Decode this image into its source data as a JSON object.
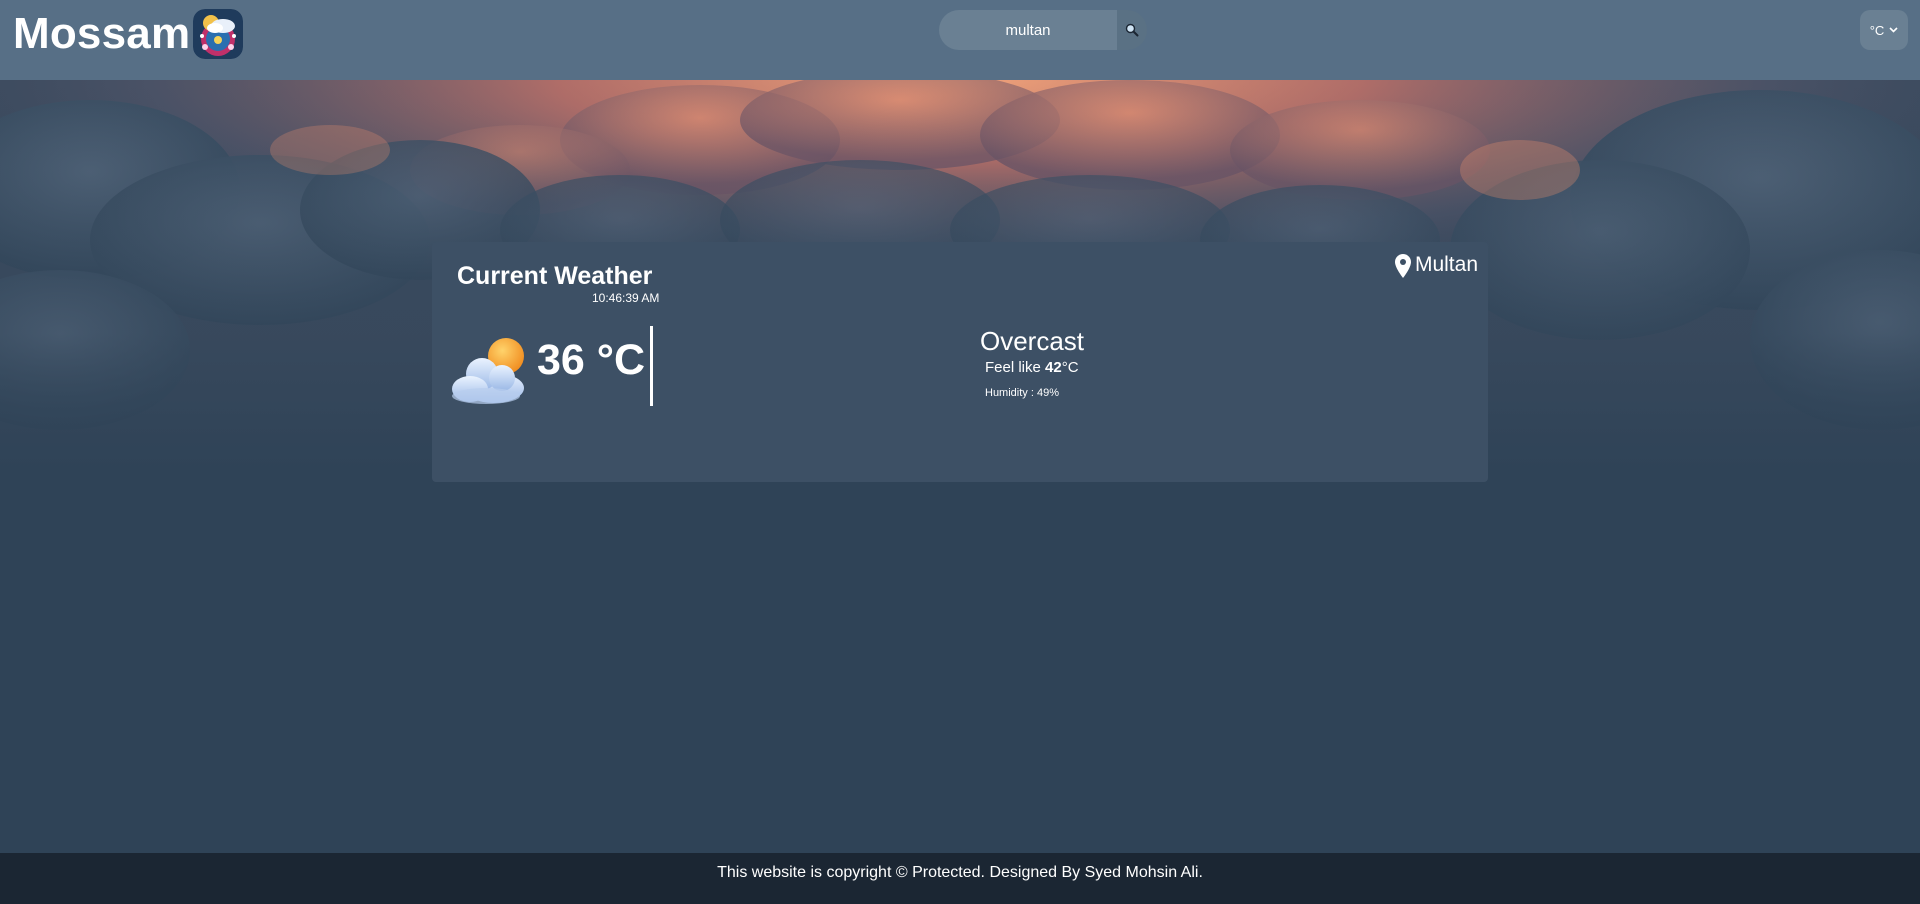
{
  "header": {
    "brand": "Mossam",
    "search": {
      "value": "multan",
      "placeholder": ""
    },
    "unit_selector": {
      "selected": "°C"
    }
  },
  "weather": {
    "title": "Current Weather",
    "time": "10:46:39 AM",
    "location": "Multan",
    "temperature": "36 °C",
    "condition": "Overcast",
    "feels_like_prefix": "Feel like ",
    "feels_like_value": "42",
    "feels_like_unit": "°C",
    "humidity": "Humidity : 49%",
    "icon": "partly-cloudy-icon"
  },
  "footer": {
    "text": "This website is copyright © Protected. Designed By Syed Mohsin Ali."
  },
  "colors": {
    "header_bg": "#576f86",
    "page_bg": "#2f4357",
    "card_bg": "#3d5065",
    "footer_bg": "#1b2633",
    "sky_glow": "#e8906e"
  },
  "icons": [
    "search-icon",
    "location-pin-icon",
    "chevron-down-icon",
    "partly-cloudy-icon",
    "logo-icon"
  ]
}
